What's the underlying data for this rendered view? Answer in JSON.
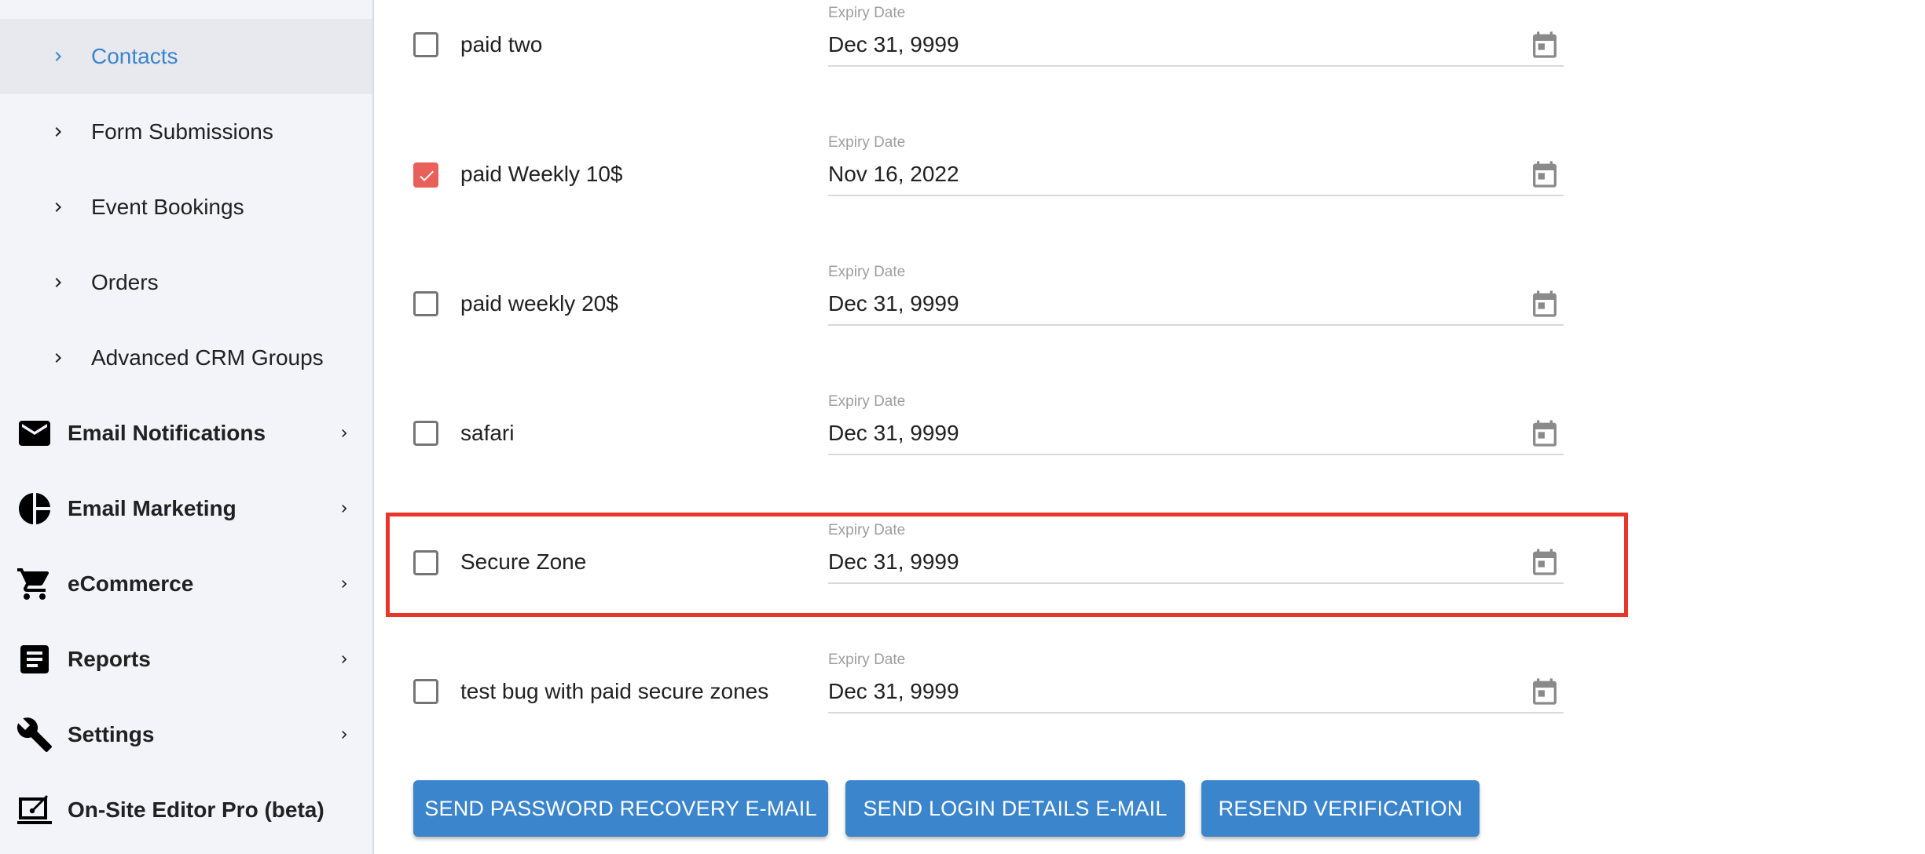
{
  "sidebar": {
    "sub_items": [
      {
        "label": "Contacts",
        "active": true
      },
      {
        "label": "Form Submissions",
        "active": false
      },
      {
        "label": "Event Bookings",
        "active": false
      },
      {
        "label": "Orders",
        "active": false
      },
      {
        "label": "Advanced CRM Groups",
        "active": false
      }
    ],
    "main_items": [
      {
        "label": "Email Notifications",
        "icon": "mail-icon",
        "has_arrow": true
      },
      {
        "label": "Email Marketing",
        "icon": "pie-chart-icon",
        "has_arrow": true
      },
      {
        "label": "eCommerce",
        "icon": "cart-icon",
        "has_arrow": true
      },
      {
        "label": "Reports",
        "icon": "report-icon",
        "has_arrow": true
      },
      {
        "label": "Settings",
        "icon": "wrench-icon",
        "has_arrow": true
      },
      {
        "label": "On-Site Editor Pro (beta)",
        "icon": "editor-icon",
        "has_arrow": false
      }
    ]
  },
  "secure_zones": {
    "field_label": "Expiry Date",
    "rows": [
      {
        "name": "paid two",
        "checked": false,
        "expiry": "Dec 31, 9999"
      },
      {
        "name": "paid Weekly 10$",
        "checked": true,
        "expiry": "Nov 16, 2022"
      },
      {
        "name": "paid weekly 20$",
        "checked": false,
        "expiry": "Dec 31, 9999"
      },
      {
        "name": "safari",
        "checked": false,
        "expiry": "Dec 31, 9999"
      },
      {
        "name": "Secure Zone",
        "checked": false,
        "expiry": "Dec 31, 9999",
        "highlighted": true
      },
      {
        "name": "test bug with paid secure zones",
        "checked": false,
        "expiry": "Dec 31, 9999"
      }
    ]
  },
  "actions": {
    "send_password_recovery": "SEND PASSWORD RECOVERY E-MAIL",
    "send_login_details": "SEND LOGIN DETAILS E-MAIL",
    "resend_verification": "RESEND VERIFICATION"
  },
  "colors": {
    "accent": "#3a85cc",
    "checkbox_checked": "#e9605a",
    "highlight_border": "#e8362d",
    "sidebar_bg": "#f2f4f9",
    "sidebar_active_bg": "#e8e9ee"
  }
}
